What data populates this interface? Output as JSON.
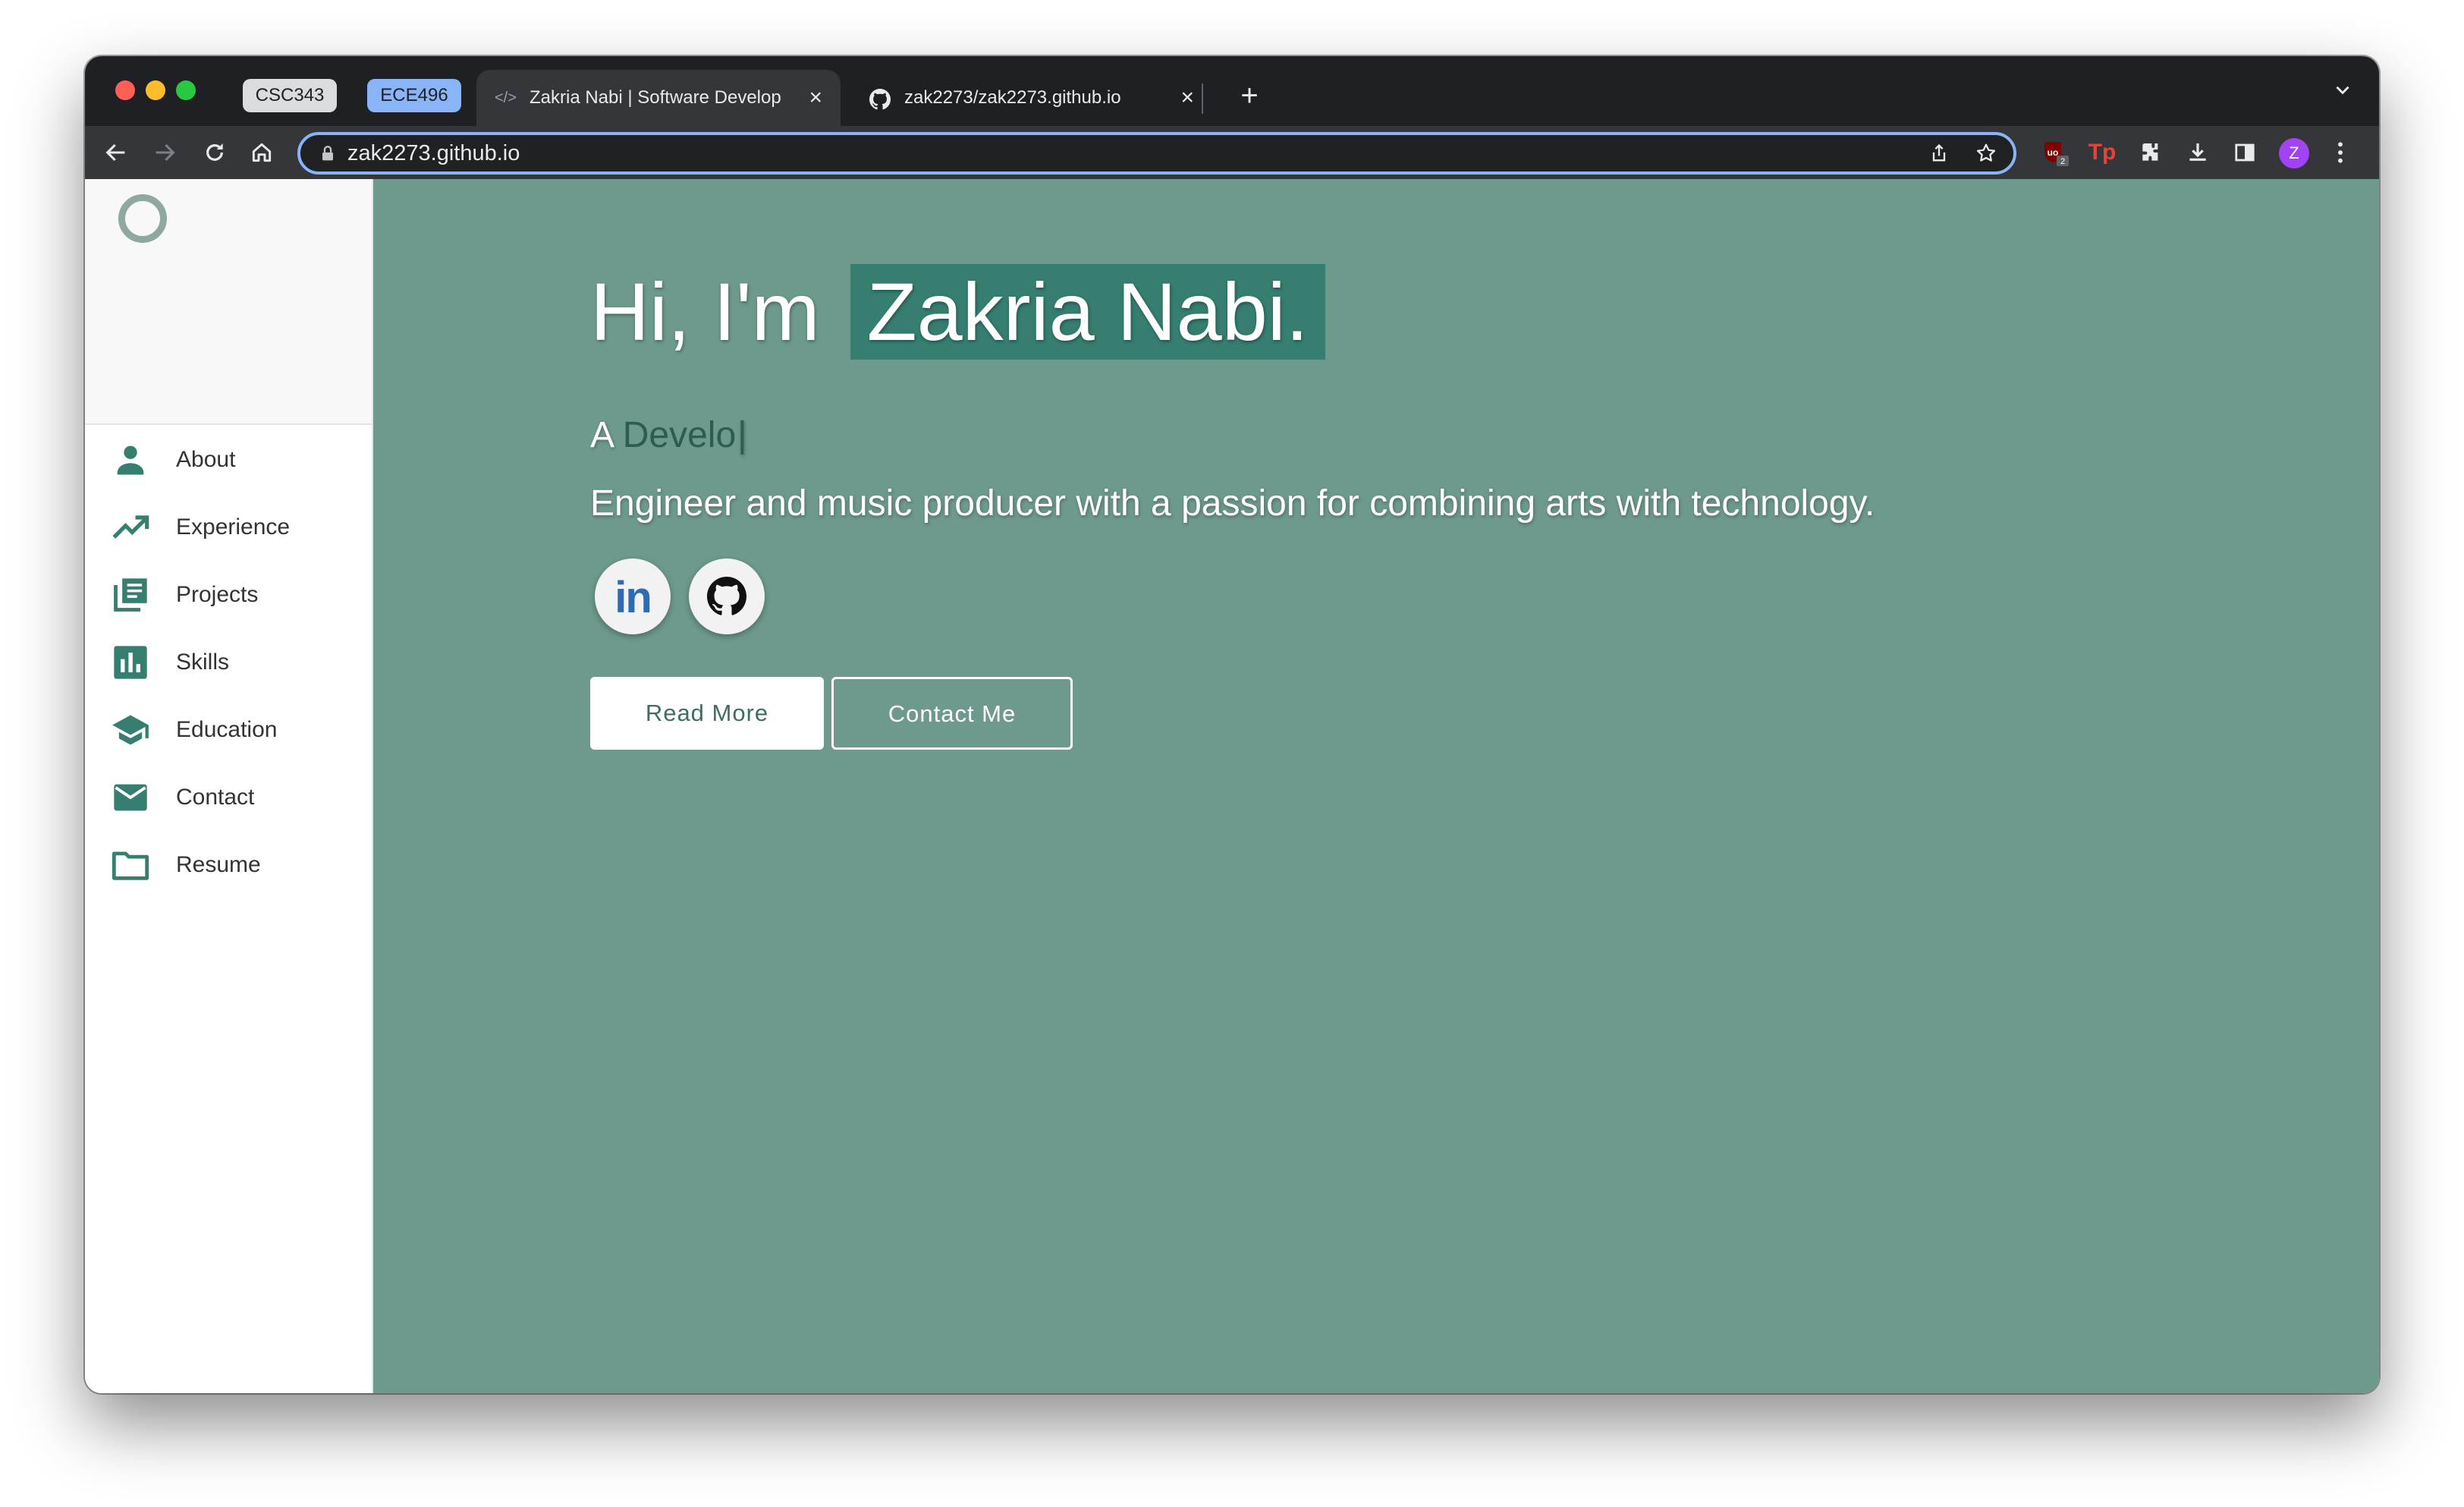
{
  "browser": {
    "tab_groups": [
      {
        "label": "CSC343",
        "color": "#dadce0"
      },
      {
        "label": "ECE496",
        "color": "#8ab4f8"
      }
    ],
    "tabs": [
      {
        "title": "Zakria Nabi | Software Develop",
        "favicon": "code-icon",
        "active": true
      },
      {
        "title": "zak2273/zak2273.github.io",
        "favicon": "github-icon",
        "active": false
      }
    ],
    "url": "zak2273.github.io",
    "avatar_letter": "Z",
    "ublock_badge": "2",
    "accent_color": "#8ab4f8"
  },
  "sidebar": {
    "items": [
      {
        "label": "About",
        "icon": "person-icon"
      },
      {
        "label": "Experience",
        "icon": "trending-up-icon"
      },
      {
        "label": "Projects",
        "icon": "library-books-icon"
      },
      {
        "label": "Skills",
        "icon": "bar-chart-icon"
      },
      {
        "label": "Education",
        "icon": "graduation-cap-icon"
      },
      {
        "label": "Contact",
        "icon": "mail-icon"
      },
      {
        "label": "Resume",
        "icon": "folder-icon"
      }
    ],
    "icon_color": "#357e70"
  },
  "hero": {
    "greeting": "Hi, I'm",
    "name": "Zakria Nabi.",
    "typing_prefix": "A",
    "typing_text": "Develo",
    "cursor": "|",
    "tagline": "Engineer and music producer with a passion for combining arts with technology.",
    "social": [
      {
        "label": "in",
        "icon": "linkedin-icon"
      },
      {
        "label": "",
        "icon": "github-icon"
      }
    ],
    "buttons": {
      "read_more": "Read More",
      "contact_me": "Contact Me"
    },
    "background": "#6e998d",
    "name_highlight": "#357e70"
  }
}
